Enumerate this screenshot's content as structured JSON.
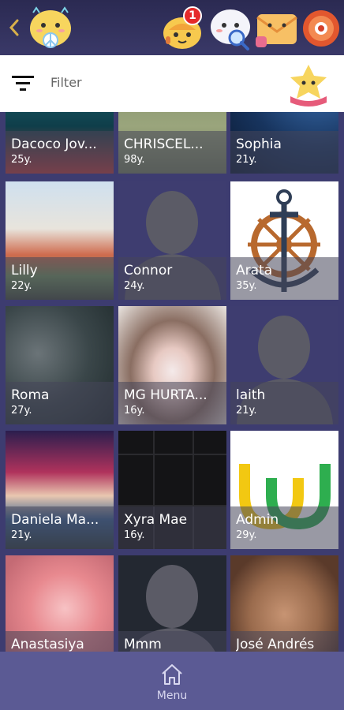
{
  "header": {
    "back_icon": "chevron-left-icon",
    "notification_count": "1",
    "icons": [
      "peace-mascot-logo",
      "bell-mascot-icon",
      "search-mascot-icon",
      "mail-mascot-icon",
      "profile-avatar-icon"
    ]
  },
  "filter": {
    "label": "Filter",
    "icon": "filter-lines-icon"
  },
  "users": [
    {
      "name": "Dacoco Jov...",
      "age": "25y."
    },
    {
      "name": "CHRISCEL...",
      "age": "98y."
    },
    {
      "name": "Sophia",
      "age": "21y."
    },
    {
      "name": "Lilly",
      "age": "22y."
    },
    {
      "name": "Connor",
      "age": "24y."
    },
    {
      "name": "Arata",
      "age": "35y."
    },
    {
      "name": "Roma",
      "age": "27y."
    },
    {
      "name": "MG HURTA...",
      "age": "16y."
    },
    {
      "name": "laith",
      "age": "21y."
    },
    {
      "name": "Daniela Ma...",
      "age": "21y."
    },
    {
      "name": "Xyra Mae",
      "age": "16y."
    },
    {
      "name": "Admin",
      "age": "29y."
    },
    {
      "name": "Anastasiya",
      "age": ""
    },
    {
      "name": "Mmm",
      "age": ""
    },
    {
      "name": "José Andrés",
      "age": ""
    }
  ],
  "bottom_nav": {
    "menu_label": "Menu",
    "icon": "home-icon"
  },
  "colors": {
    "background": "#33325e",
    "bottom_nav": "#5b5a94",
    "badge": "#e52a2a"
  }
}
